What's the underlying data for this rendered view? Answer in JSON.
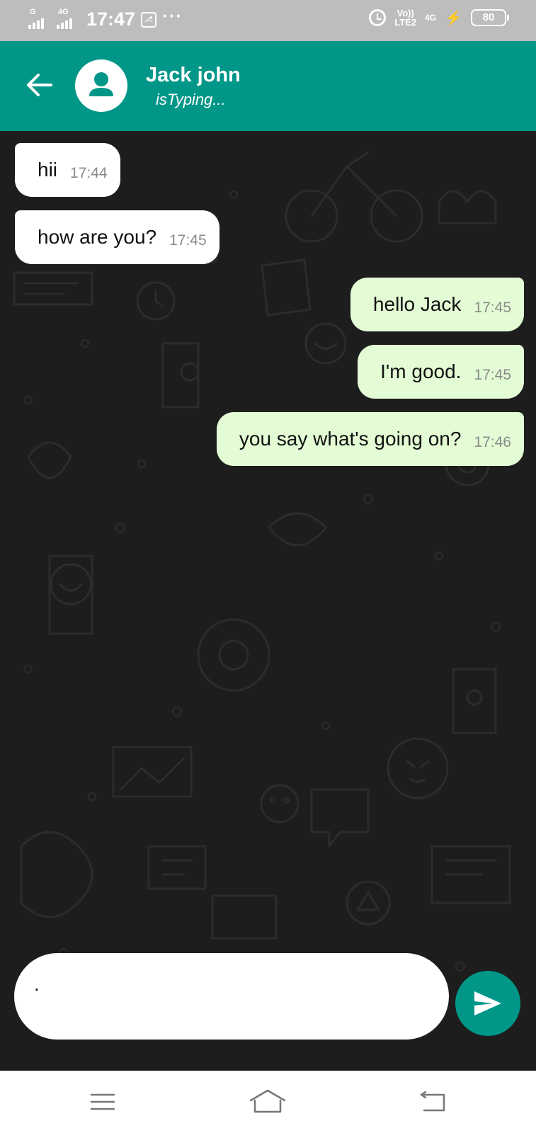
{
  "status_bar": {
    "sim1_label": "G",
    "sim2_label": "4G",
    "time": "17:47",
    "usb_label": "USB",
    "more_label": "···",
    "volte_top": "Vo))",
    "volte_bottom": "LTE2",
    "network_label": "4G",
    "battery_level": "80"
  },
  "header": {
    "contact_name": "Jack john",
    "contact_status": "isTyping...",
    "accent_color": "#009688"
  },
  "messages": [
    {
      "direction": "incoming",
      "text": "hii",
      "time": "17:44"
    },
    {
      "direction": "incoming",
      "text": "how are you?",
      "time": "17:45"
    },
    {
      "direction": "outgoing",
      "text": "hello Jack",
      "time": "17:45"
    },
    {
      "direction": "outgoing",
      "text": "I'm good.",
      "time": "17:45"
    },
    {
      "direction": "outgoing",
      "text": "you say what's going on?",
      "time": "17:46"
    }
  ],
  "composer": {
    "value": "."
  },
  "icons": {
    "back": "arrow-left-icon",
    "avatar": "person-icon",
    "send": "send-icon",
    "nav_menu": "menu-icon",
    "nav_home": "home-icon",
    "nav_back": "back-icon"
  }
}
